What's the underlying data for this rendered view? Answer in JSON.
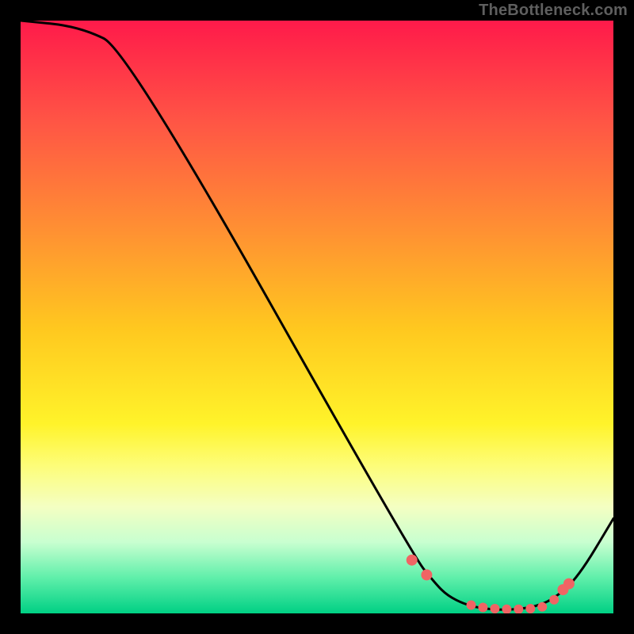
{
  "attribution": "TheBottleneck.com",
  "chart_data": {
    "type": "line",
    "title": "",
    "xlabel": "",
    "ylabel": "",
    "xlim": [
      0,
      100
    ],
    "ylim": [
      0,
      100
    ],
    "series": [
      {
        "name": "curve",
        "x": [
          0,
          10,
          18,
          66,
          70,
          72,
          75,
          78,
          81,
          84,
          87,
          90,
          94,
          100
        ],
        "y": [
          100,
          99,
          95,
          10,
          5,
          3,
          1.5,
          0.8,
          0.6,
          0.7,
          1.2,
          2.5,
          6,
          16
        ]
      }
    ],
    "markers": {
      "x": [
        66,
        68.5,
        76,
        78,
        80,
        82,
        84,
        86,
        88,
        90,
        91.5,
        92.5
      ],
      "y": [
        9,
        6.5,
        1.4,
        1.0,
        0.8,
        0.7,
        0.7,
        0.8,
        1.1,
        2.3,
        4.0,
        5.0
      ],
      "r_small": 6,
      "r_large": 7
    }
  }
}
